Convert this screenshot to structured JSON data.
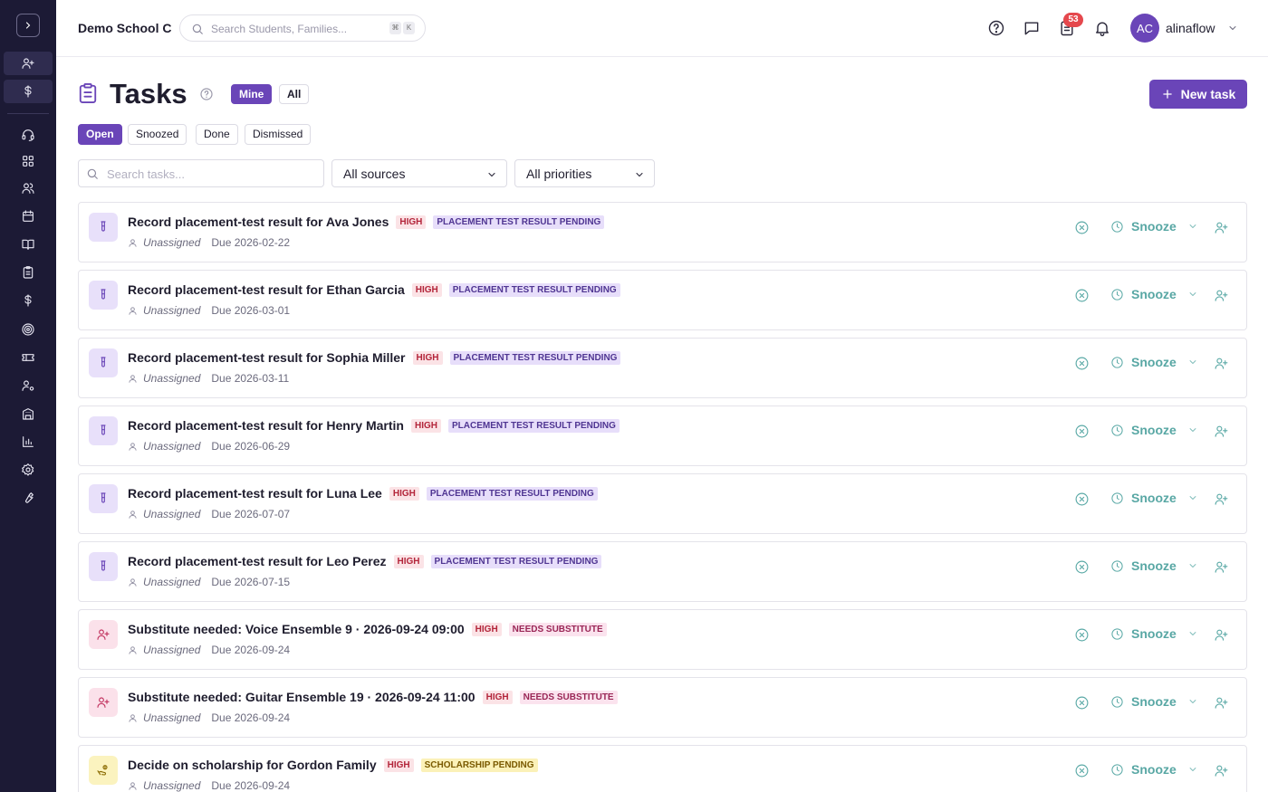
{
  "sidebar": {
    "toggle_icon": "chevron-right-icon",
    "items": [
      {
        "icon": "user-plus-icon",
        "active": true
      },
      {
        "icon": "dollar-icon",
        "active": true
      },
      {
        "icon": "headset-icon"
      },
      {
        "icon": "grid-icon"
      },
      {
        "icon": "users-icon"
      },
      {
        "icon": "calendar-icon"
      },
      {
        "icon": "book-icon"
      },
      {
        "icon": "clipboard-icon"
      },
      {
        "icon": "dollar-icon"
      },
      {
        "icon": "target-icon"
      },
      {
        "icon": "ticket-icon"
      },
      {
        "icon": "user-gear-icon"
      },
      {
        "icon": "building-icon"
      },
      {
        "icon": "bar-chart-icon"
      },
      {
        "icon": "settings-icon"
      },
      {
        "icon": "wrench-icon"
      }
    ]
  },
  "topbar": {
    "school_name": "Demo School C",
    "search_placeholder": "Search Students, Families...",
    "shortcut_keys": [
      "⌘",
      "K"
    ],
    "notification_count": "53",
    "avatar_initials": "AC",
    "username": "alinaflow"
  },
  "header": {
    "title": "Tasks",
    "scope_mine": "Mine",
    "scope_all": "All",
    "new_task_label": "New task"
  },
  "filters": {
    "status_tabs": [
      "Open",
      "Snoozed",
      "Done",
      "Dismissed"
    ],
    "active_status": "Open",
    "search_placeholder": "Search tasks...",
    "source_selected": "All sources",
    "priority_selected": "All priorities"
  },
  "task_actions": {
    "snooze_label": "Snooze"
  },
  "tasks": [
    {
      "title": "Record placement-test result for Ava Jones",
      "priority": "HIGH",
      "category": "PLACEMENT TEST RESULT PENDING",
      "assignee": "Unassigned",
      "due": "Due 2026-02-22",
      "kind": "placement",
      "color": "#e8e0fa"
    },
    {
      "title": "Record placement-test result for Ethan Garcia",
      "priority": "HIGH",
      "category": "PLACEMENT TEST RESULT PENDING",
      "assignee": "Unassigned",
      "due": "Due 2026-03-01",
      "kind": "placement",
      "color": "#e8e0fa"
    },
    {
      "title": "Record placement-test result for Sophia Miller",
      "priority": "HIGH",
      "category": "PLACEMENT TEST RESULT PENDING",
      "assignee": "Unassigned",
      "due": "Due 2026-03-11",
      "kind": "placement",
      "color": "#e8e0fa"
    },
    {
      "title": "Record placement-test result for Henry Martin",
      "priority": "HIGH",
      "category": "PLACEMENT TEST RESULT PENDING",
      "assignee": "Unassigned",
      "due": "Due 2026-06-29",
      "kind": "placement",
      "color": "#e8e0fa"
    },
    {
      "title": "Record placement-test result for Luna Lee",
      "priority": "HIGH",
      "category": "PLACEMENT TEST RESULT PENDING",
      "assignee": "Unassigned",
      "due": "Due 2026-07-07",
      "kind": "placement",
      "color": "#e8e0fa"
    },
    {
      "title": "Record placement-test result for Leo Perez",
      "priority": "HIGH",
      "category": "PLACEMENT TEST RESULT PENDING",
      "assignee": "Unassigned",
      "due": "Due 2026-07-15",
      "kind": "placement",
      "color": "#e8e0fa"
    },
    {
      "title": "Substitute needed: Voice Ensemble 9 · 2026-09-24 09:00",
      "priority": "HIGH",
      "category": "NEEDS SUBSTITUTE",
      "assignee": "Unassigned",
      "due": "Due 2026-09-24",
      "kind": "substitute",
      "color": "#fbe1ea"
    },
    {
      "title": "Substitute needed: Guitar Ensemble 19 · 2026-09-24 11:00",
      "priority": "HIGH",
      "category": "NEEDS SUBSTITUTE",
      "assignee": "Unassigned",
      "due": "Due 2026-09-24",
      "kind": "substitute",
      "color": "#fbe1ea"
    },
    {
      "title": "Decide on scholarship for Gordon Family",
      "priority": "HIGH",
      "category": "SCHOLARSHIP PENDING",
      "assignee": "Unassigned",
      "due": "Due 2026-09-24",
      "kind": "scholarship",
      "color": "#fbf3bf"
    }
  ]
}
